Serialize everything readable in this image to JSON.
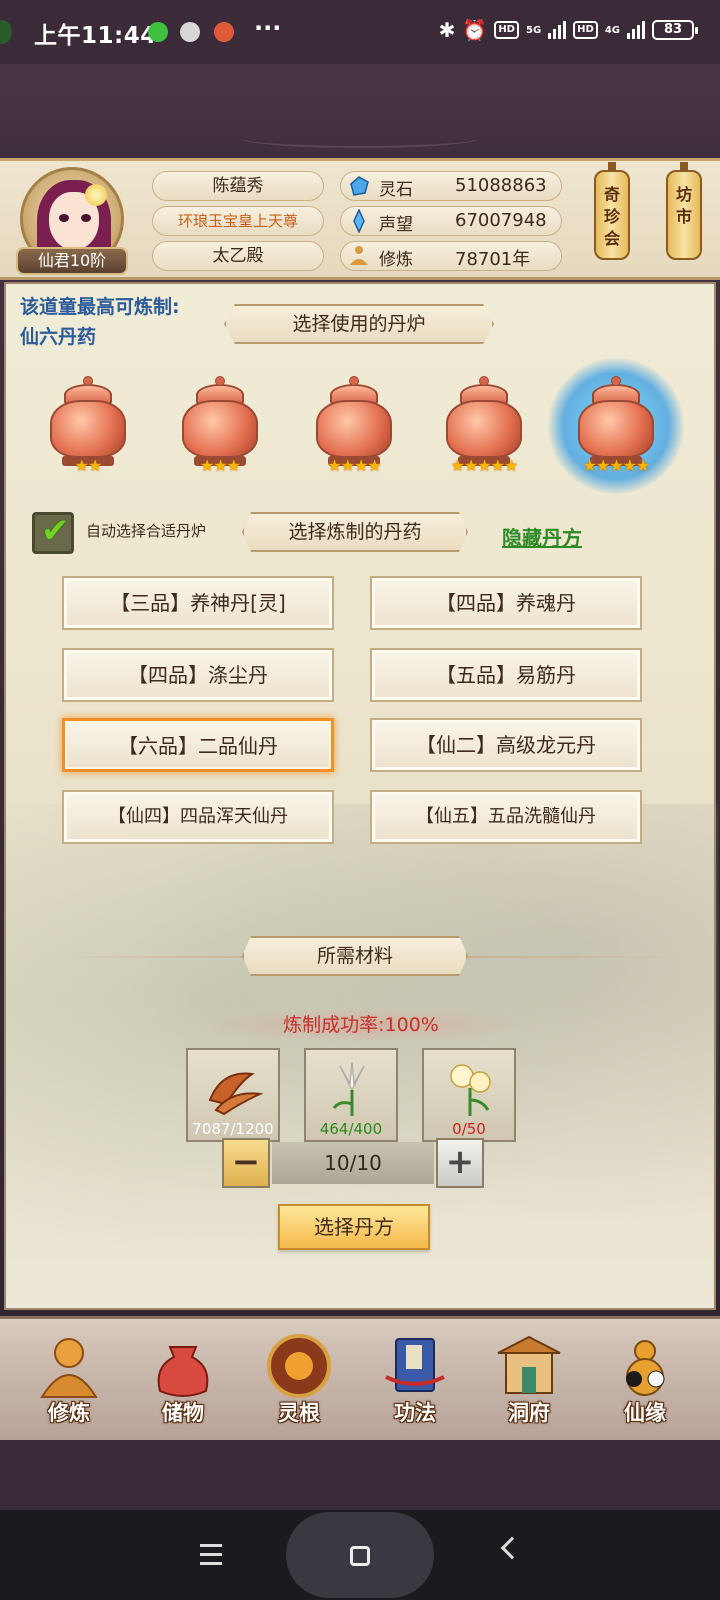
{
  "status_bar": {
    "time": "上午11:44",
    "more": "···",
    "signal_5g": "5G",
    "signal_4g": "4G",
    "hd1": "HD",
    "hd2": "HD",
    "battery": "83"
  },
  "profile": {
    "rank": "仙君10阶",
    "name": "陈蕴秀",
    "title": "环琅玉宝皇上天尊",
    "location": "太乙殿"
  },
  "stats": [
    {
      "label": "灵石",
      "value": "51088863"
    },
    {
      "label": "声望",
      "value": "67007948"
    },
    {
      "label": "修炼",
      "value": "78701年"
    }
  ],
  "lanterns": {
    "left": "奇珍会",
    "right": "坊市"
  },
  "panel": {
    "info_line1": "该道童最高可炼制:",
    "info_line2": "仙六丹药",
    "furnace_banner": "选择使用的丹炉",
    "furnace_stars": [
      "★★",
      "★★★",
      "★★★★",
      "★★★★★",
      "★★★★★"
    ],
    "auto_select_label": "自动选择合适丹炉",
    "recipe_banner": "选择炼制的丹药",
    "hide_recipe_link": "隐藏丹方",
    "recipes": [
      "【三品】养神丹[灵]",
      "【四品】养魂丹",
      "【四品】涤尘丹",
      "【五品】易筋丹",
      "【六品】二品仙丹",
      "【仙二】高级龙元丹",
      "【仙四】四品浑天仙丹",
      "【仙五】五品洗髓仙丹"
    ],
    "selected_recipe_index": 4,
    "materials_banner": "所需材料",
    "success_rate": "炼制成功率:100%",
    "materials": [
      {
        "count": "7087/1200",
        "color": "#ffffff"
      },
      {
        "count": "464/400",
        "color": "#2b8a1e"
      },
      {
        "count": "0/50",
        "color": "#d0201a"
      }
    ],
    "quantity": "10/10",
    "minus": "−",
    "plus": "+",
    "select_button": "选择丹方"
  },
  "bottom_nav": [
    "修炼",
    "储物",
    "灵根",
    "功法",
    "洞府",
    "仙缘"
  ],
  "colors": {
    "accent": "#f0902a",
    "link": "#2e8a24",
    "info": "#2c5c9a",
    "rate": "#c8302a"
  }
}
